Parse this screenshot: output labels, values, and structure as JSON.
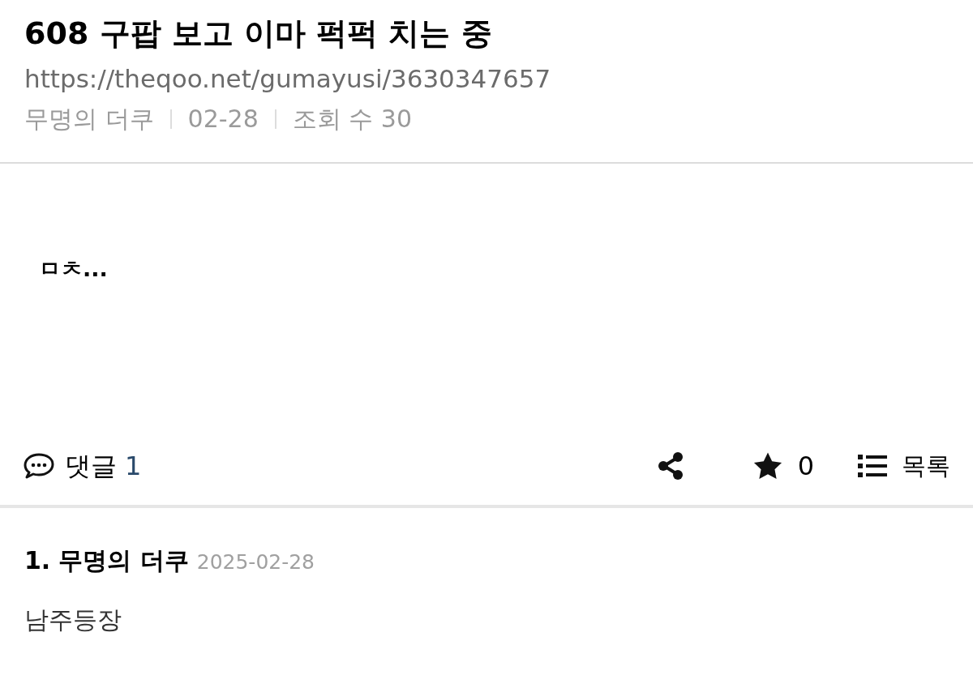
{
  "post": {
    "title": "608 구팝 보고 이마 퍽퍽 치는 중",
    "url": "https://theqoo.net/gumayusi/3630347657",
    "meta": [
      "무명의 더쿠",
      "02-28",
      "조회 수 30"
    ],
    "body": "ㅁㅊ..."
  },
  "actions": {
    "comment_label": "댓글",
    "comment_count": "1",
    "star_count": "0",
    "list_label": "목록"
  },
  "comments": [
    {
      "number": "1.",
      "author": "무명의 더쿠",
      "date": "2025-02-28",
      "text": "남주등장"
    }
  ]
}
